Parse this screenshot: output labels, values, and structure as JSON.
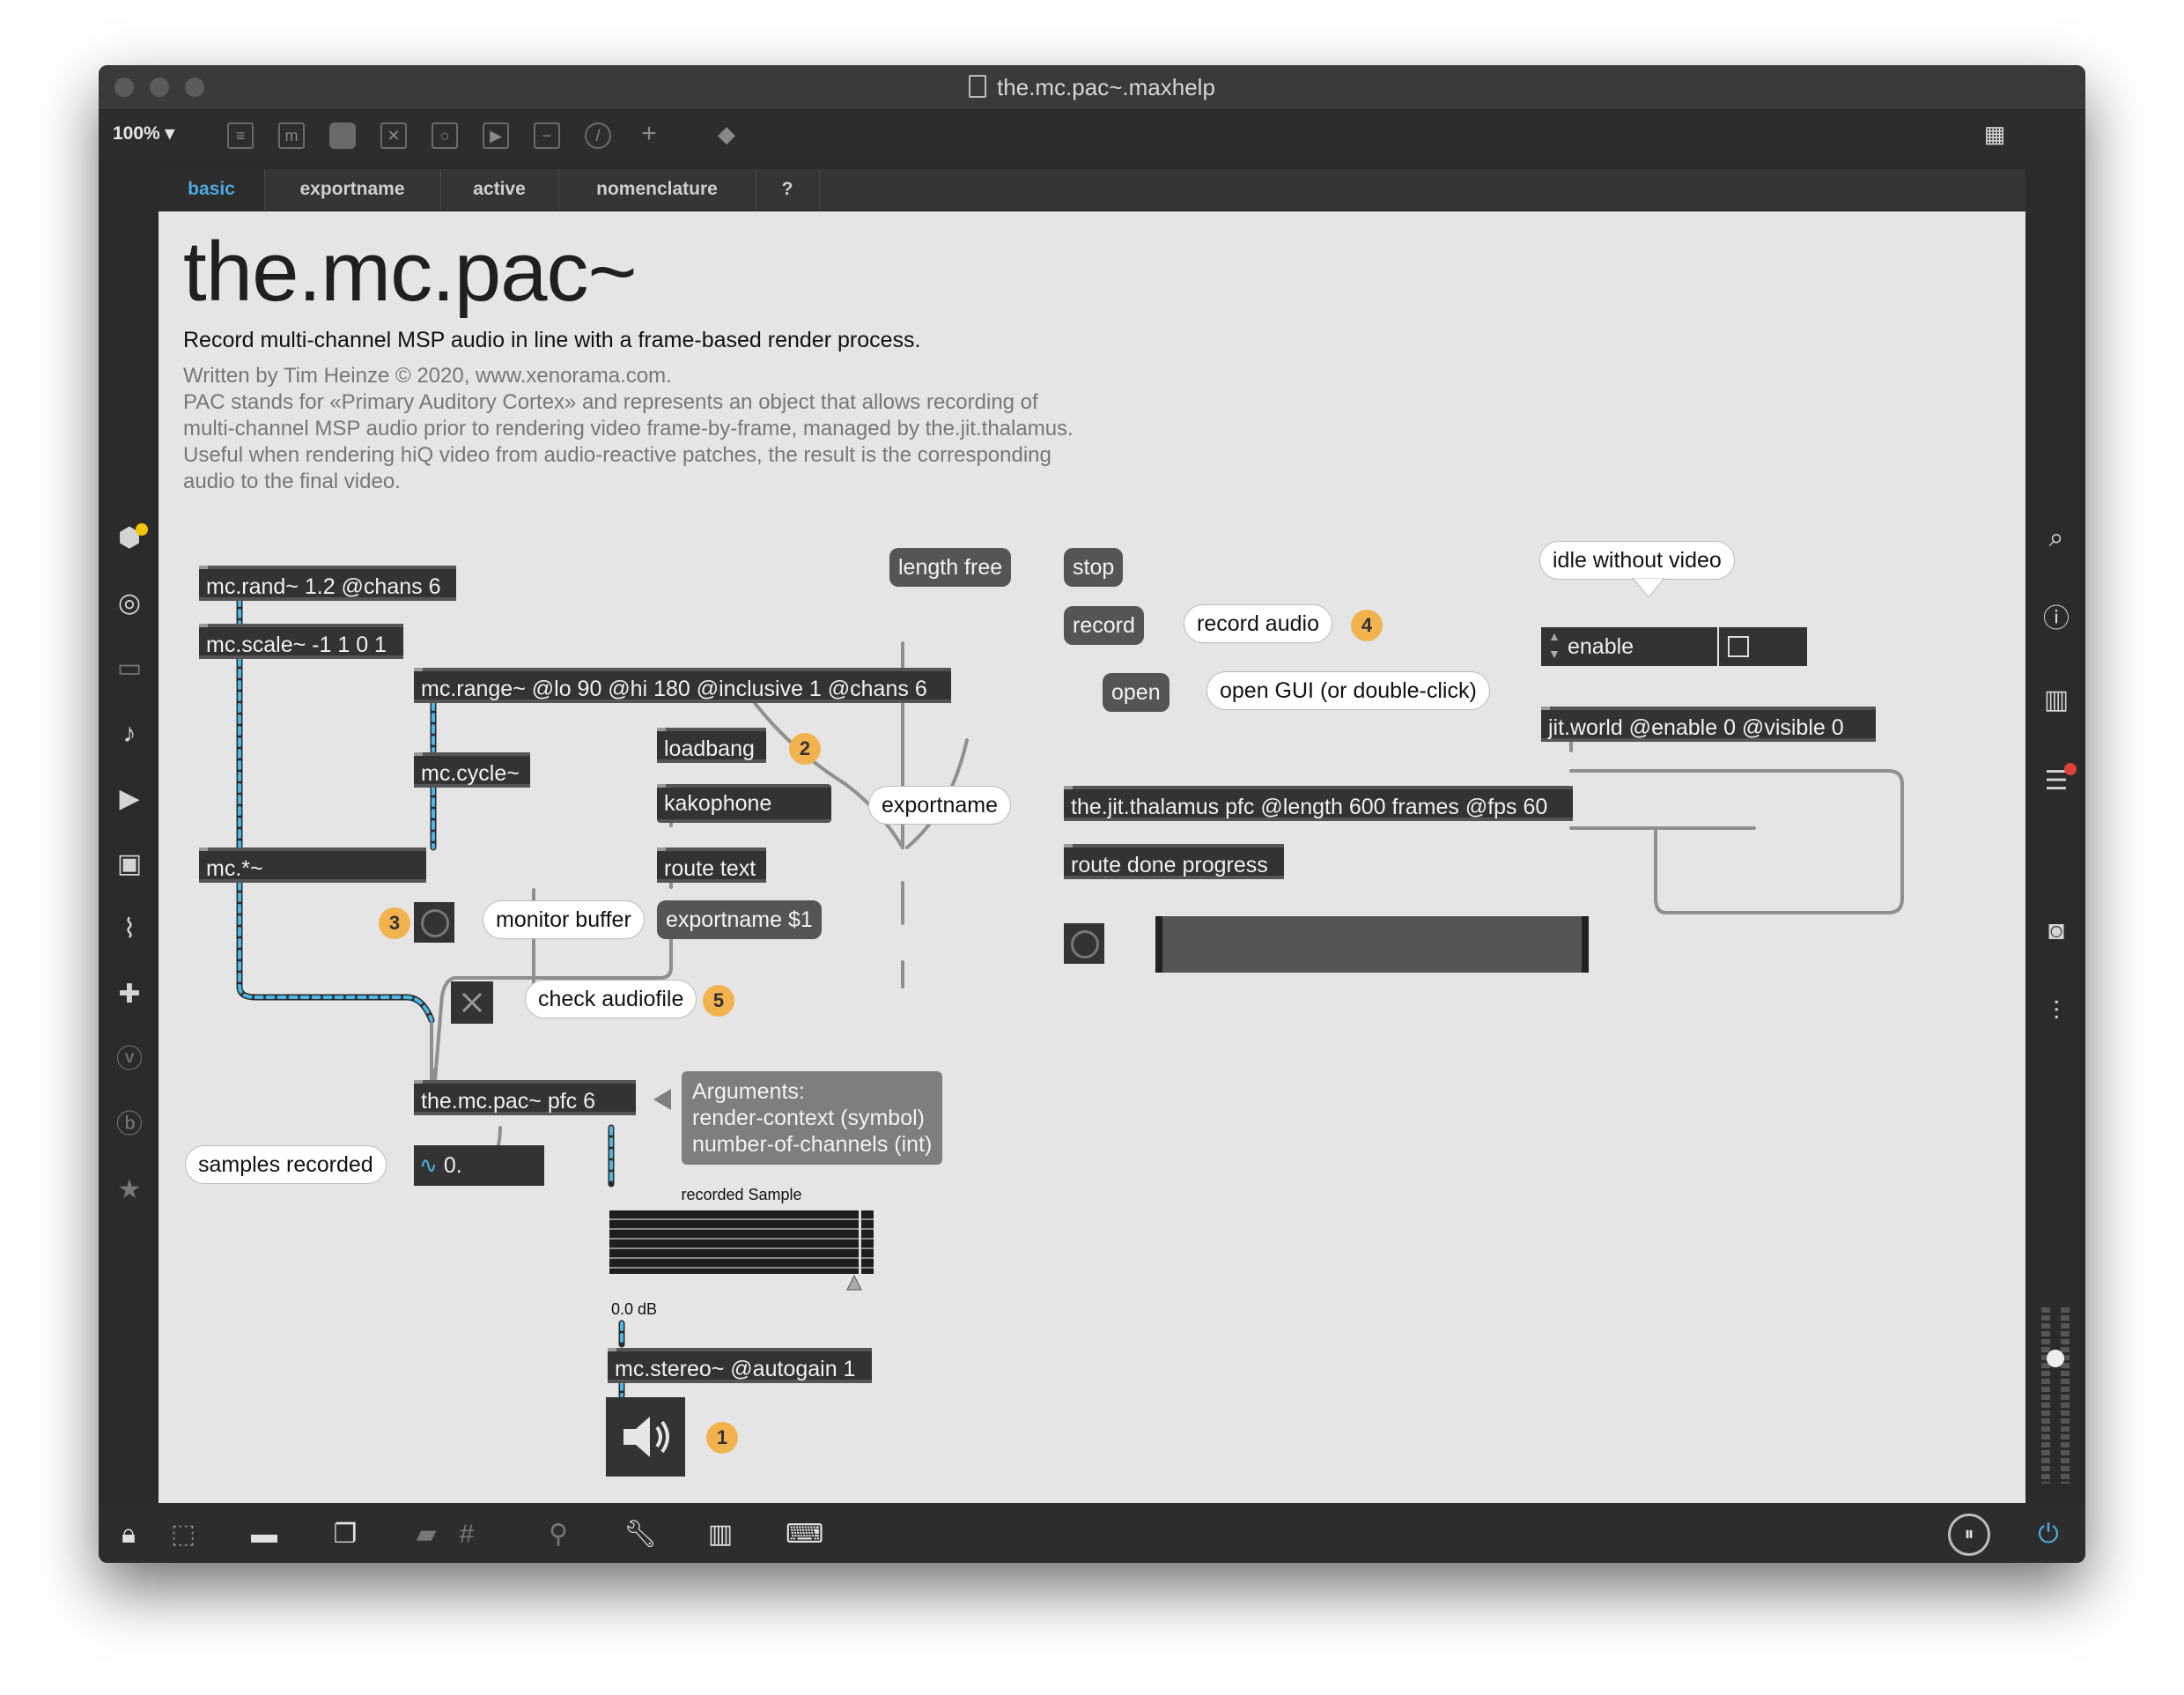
{
  "window": {
    "title": "the.mc.pac~.maxhelp"
  },
  "toolbar": {
    "zoom": "100% ▾"
  },
  "tabs": [
    {
      "label": "basic"
    },
    {
      "label": "exportname"
    },
    {
      "label": "active"
    },
    {
      "label": "nomenclature"
    },
    {
      "label": "?"
    }
  ],
  "header": {
    "title": "the.mc.pac~",
    "subtitle": "Record multi-channel MSP audio in line with a frame-based render process.",
    "desc": [
      "Written by Tim Heinze © 2020, www.xenorama.com.",
      "PAC stands for «Primary Auditory Cortex» and represents an object that allows recording of",
      "multi-channel MSP audio prior to rendering video frame-by-frame, managed by the.jit.thalamus.",
      "Useful when rendering hiQ video from audio-reactive patches, the result is the corresponding",
      "audio to the final video."
    ]
  },
  "patch": {
    "mc_rand": "mc.rand~ 1.2 @chans 6",
    "mc_scale": "mc.scale~ -1 1 0 1",
    "mc_range": "mc.range~ @lo 90 @hi 180 @inclusive 1 @chans 6",
    "mc_cycle": "mc.cycle~",
    "mc_times": "mc.*~",
    "loadbang": "loadbang",
    "kakophone": "kakophone",
    "route_text": "route text",
    "exportname_msg": "exportname $1",
    "exportname_cmt": "exportname",
    "monitor_buffer": "monitor buffer",
    "check_audiofile": "check audiofile",
    "pac": "the.mc.pac~ pfc 6",
    "arguments": [
      "Arguments:",
      "render-context (symbol)",
      "number-of-channels (int)"
    ],
    "samples_recorded": "samples recorded",
    "number": "0.",
    "waveform_title": "recorded Sample",
    "gain": "0.0 dB",
    "mc_stereo": "mc.stereo~ @autogain 1",
    "length_free": "length free",
    "stop": "stop",
    "record": "record",
    "record_audio": "record audio",
    "open": "open",
    "open_gui": "open GUI (or double-click)",
    "idle": "idle without video",
    "enable": "enable",
    "jit_world": "jit.world @enable 0 @visible 0",
    "thalamus": "the.jit.thalamus pfc @length 600 frames @fps 60",
    "route_done": "route done progress",
    "progress": 0
  },
  "badges": [
    "1",
    "2",
    "3",
    "4",
    "5"
  ],
  "colors": {
    "accent": "#4fa9e0",
    "badge": "#f2b34f",
    "canvas": "#e5e5e5",
    "mcCable": "#4ab7e6"
  }
}
